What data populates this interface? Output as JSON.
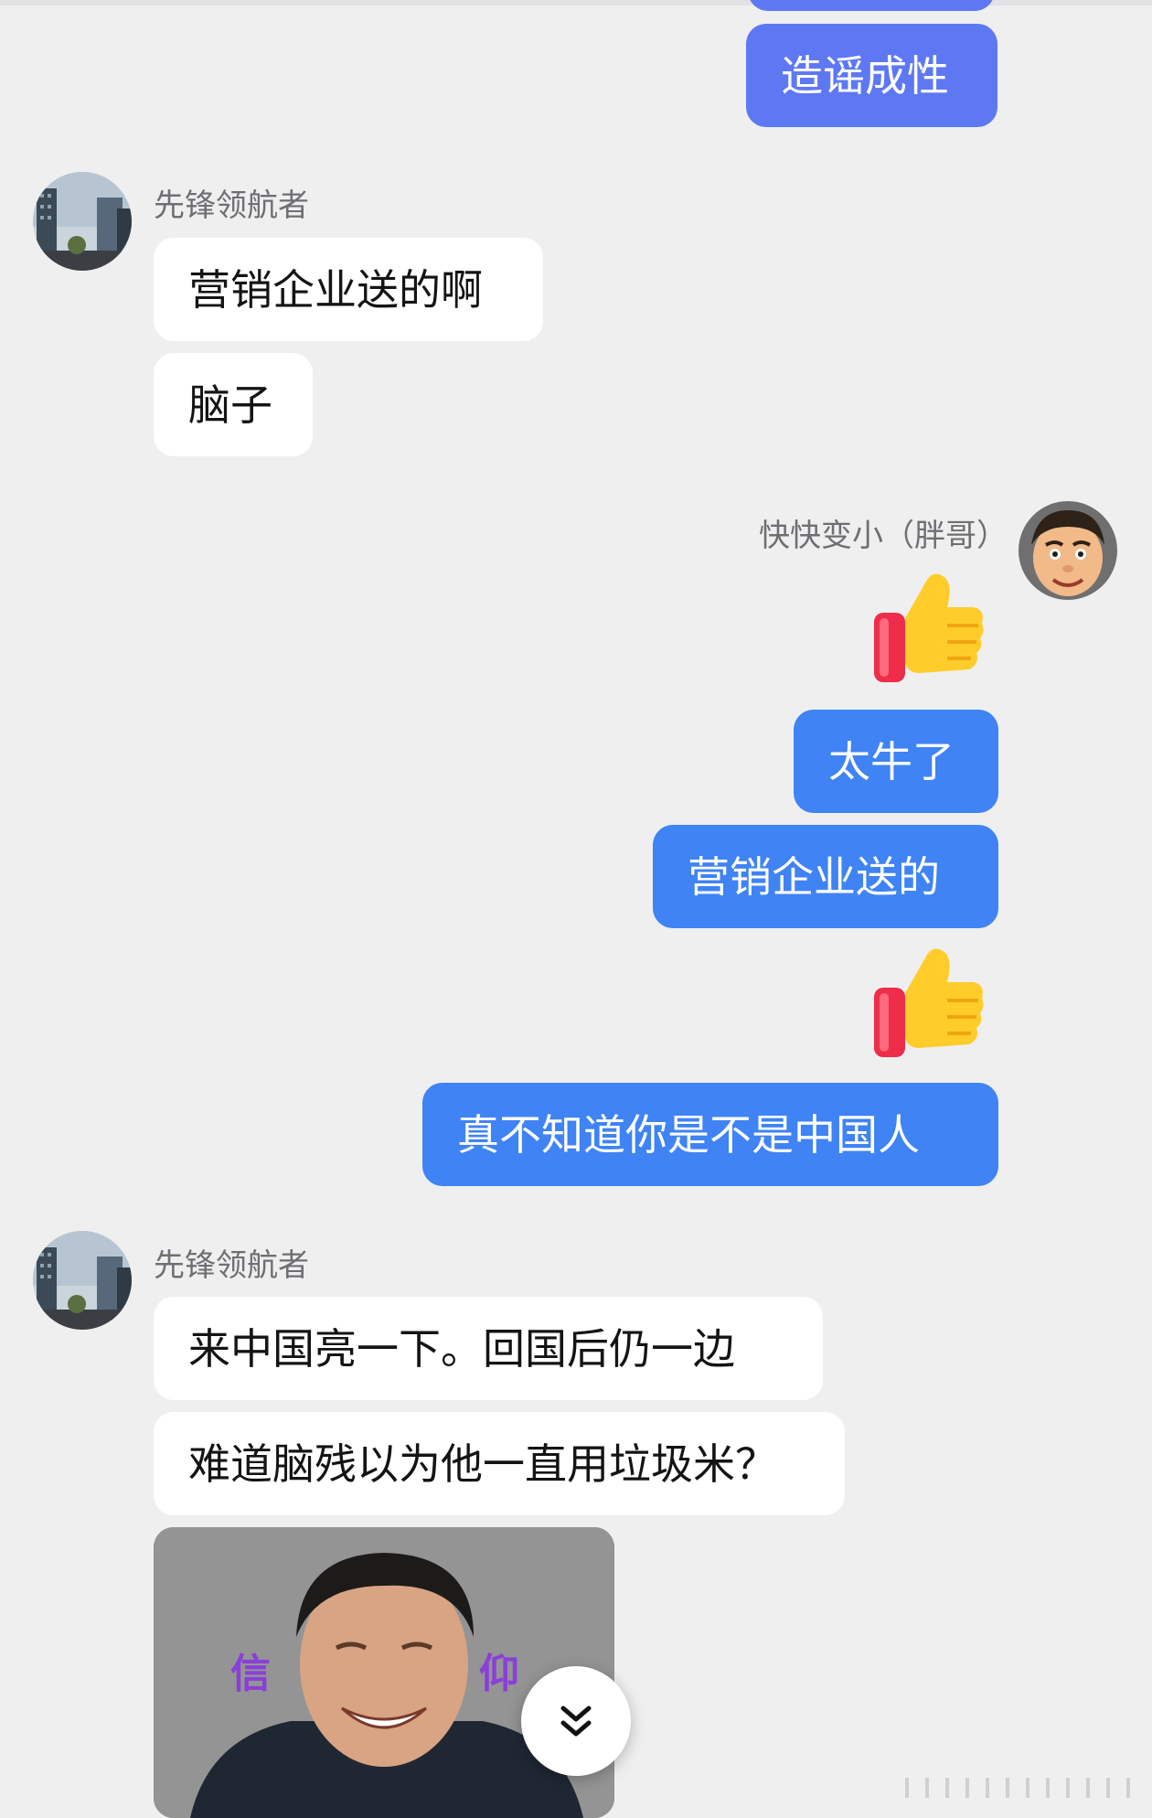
{
  "messages": [
    {
      "sender": "me",
      "text": "造谣成性"
    },
    {
      "sender_name": "先锋领航者",
      "texts": [
        "营销企业送的啊",
        "脑子"
      ]
    },
    {
      "sender_name": "快快变小（胖哥）",
      "texts": [
        "太牛了",
        "营销企业送的",
        "真不知道你是不是中国人"
      ],
      "emojis": [
        "thumbs-up",
        "thumbs-up"
      ]
    },
    {
      "sender_name": "先锋领航者",
      "texts": [
        "来中国亮一下。回国后仍一边",
        "难道脑残以为他一直用垃圾米？"
      ]
    }
  ],
  "image_message": {
    "overlay_left": "信",
    "overlay_right": "仰"
  },
  "colors": {
    "incoming": "#ffffff",
    "outgoing": "#3f83f4",
    "background": "#efeff0",
    "accent_purple": "#5e78f4"
  }
}
